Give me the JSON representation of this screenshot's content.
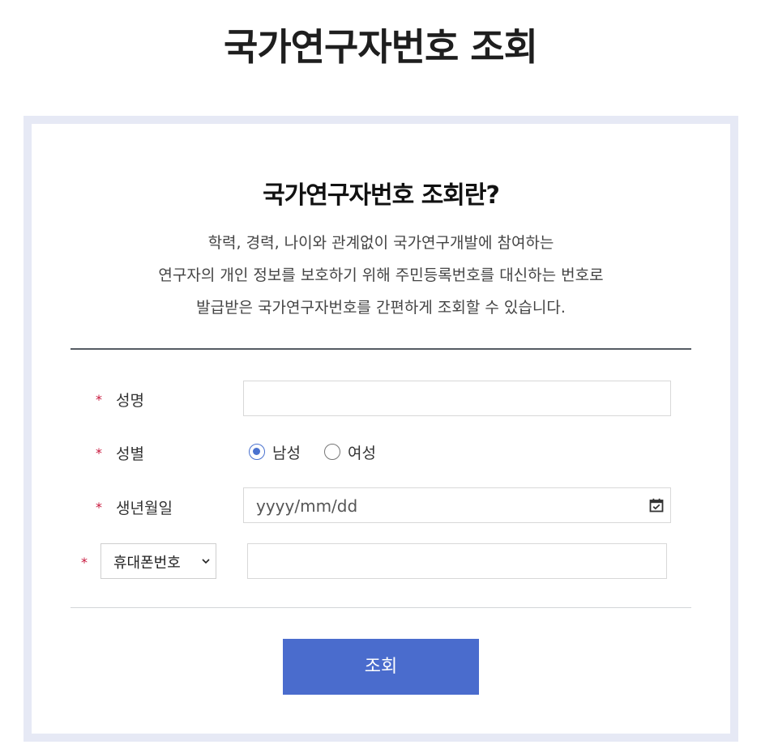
{
  "page": {
    "title": "국가연구자번호 조회"
  },
  "intro": {
    "title": "국가연구자번호 조회란?",
    "lines": [
      "학력, 경력, 나이와 관계없이 국가연구개발에 참여하는",
      "연구자의 개인 정보를 보호하기 위해 주민등록번호를 대신하는 번호로",
      "발급받은 국가연구자번호를 간편하게 조회할 수 있습니다."
    ]
  },
  "form": {
    "required_mark": "*",
    "name": {
      "label": "성명",
      "value": ""
    },
    "gender": {
      "label": "성별",
      "options": [
        "남성",
        "여성"
      ],
      "selected": "남성"
    },
    "birthdate": {
      "label": "생년월일",
      "placeholder": "yyyy/mm/dd",
      "icon": "calendar-icon"
    },
    "contact": {
      "type_selected": "휴대폰번호",
      "value": ""
    },
    "submit_label": "조회"
  },
  "colors": {
    "accent": "#4a6ccd",
    "required": "#c8173c",
    "frame": "#e6e9f5"
  }
}
